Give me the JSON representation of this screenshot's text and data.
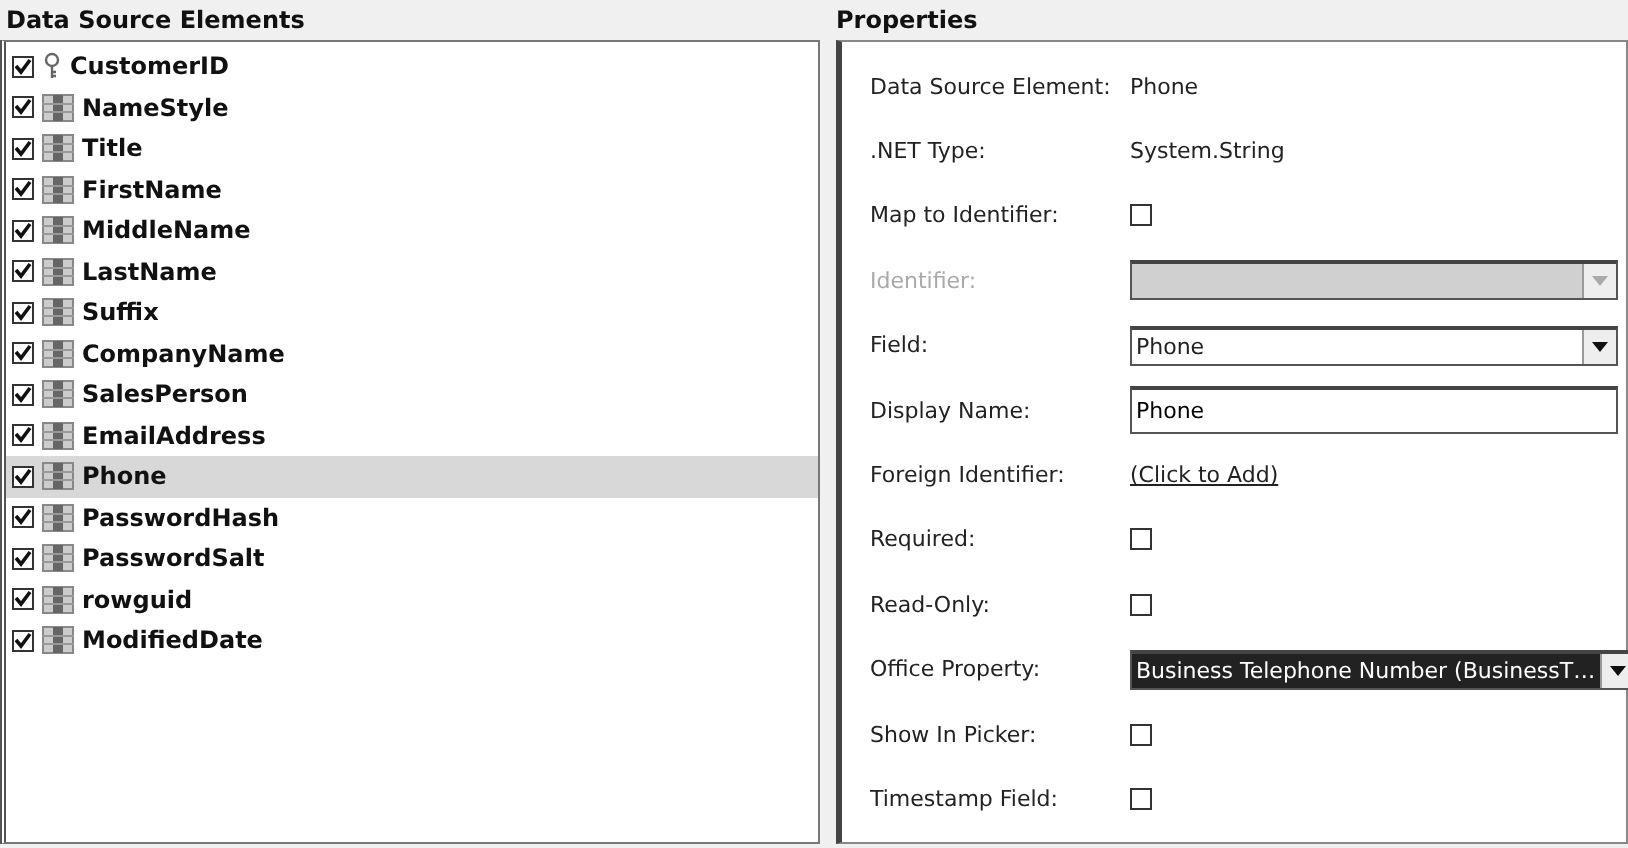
{
  "data_source_elements": {
    "title": "Data Source Elements",
    "items": [
      {
        "name": "CustomerID",
        "checked": true,
        "kind": "key",
        "selected": false
      },
      {
        "name": "NameStyle",
        "checked": true,
        "kind": "column",
        "selected": false
      },
      {
        "name": "Title",
        "checked": true,
        "kind": "column",
        "selected": false
      },
      {
        "name": "FirstName",
        "checked": true,
        "kind": "column",
        "selected": false
      },
      {
        "name": "MiddleName",
        "checked": true,
        "kind": "column",
        "selected": false
      },
      {
        "name": "LastName",
        "checked": true,
        "kind": "column",
        "selected": false
      },
      {
        "name": "Suffix",
        "checked": true,
        "kind": "column",
        "selected": false
      },
      {
        "name": "CompanyName",
        "checked": true,
        "kind": "column",
        "selected": false
      },
      {
        "name": "SalesPerson",
        "checked": true,
        "kind": "column",
        "selected": false
      },
      {
        "name": "EmailAddress",
        "checked": true,
        "kind": "column",
        "selected": false
      },
      {
        "name": "Phone",
        "checked": true,
        "kind": "column",
        "selected": true
      },
      {
        "name": "PasswordHash",
        "checked": true,
        "kind": "column",
        "selected": false
      },
      {
        "name": "PasswordSalt",
        "checked": true,
        "kind": "column",
        "selected": false
      },
      {
        "name": "rowguid",
        "checked": true,
        "kind": "column",
        "selected": false
      },
      {
        "name": "ModifiedDate",
        "checked": true,
        "kind": "column",
        "selected": false
      }
    ]
  },
  "properties": {
    "title": "Properties",
    "rows": [
      {
        "label": "Data Source Element:",
        "kind": "text",
        "value": "Phone"
      },
      {
        "label": ".NET Type:",
        "kind": "text",
        "value": "System.String"
      },
      {
        "label": "Map to Identifier:",
        "kind": "checkbox",
        "checked": false
      },
      {
        "label": "Identifier:",
        "kind": "select",
        "disabled": true
      },
      {
        "label": "Field:",
        "kind": "select",
        "value": "Phone",
        "disabled": false
      },
      {
        "label": "Display Name:",
        "kind": "input",
        "value": "Phone"
      },
      {
        "label": "Foreign Identifier:",
        "kind": "link",
        "value": "(Click to Add)"
      },
      {
        "label": "Required:",
        "kind": "checkbox",
        "checked": false
      },
      {
        "label": "Read-Only:",
        "kind": "checkbox",
        "checked": false
      },
      {
        "label": "Office Property:",
        "kind": "select",
        "value": "Business Telephone Number (BusinessT…",
        "disabled": false,
        "highlighted": true
      },
      {
        "label": "Show In Picker:",
        "kind": "checkbox",
        "checked": false
      },
      {
        "label": "Timestamp Field:",
        "kind": "checkbox",
        "checked": false
      }
    ]
  }
}
